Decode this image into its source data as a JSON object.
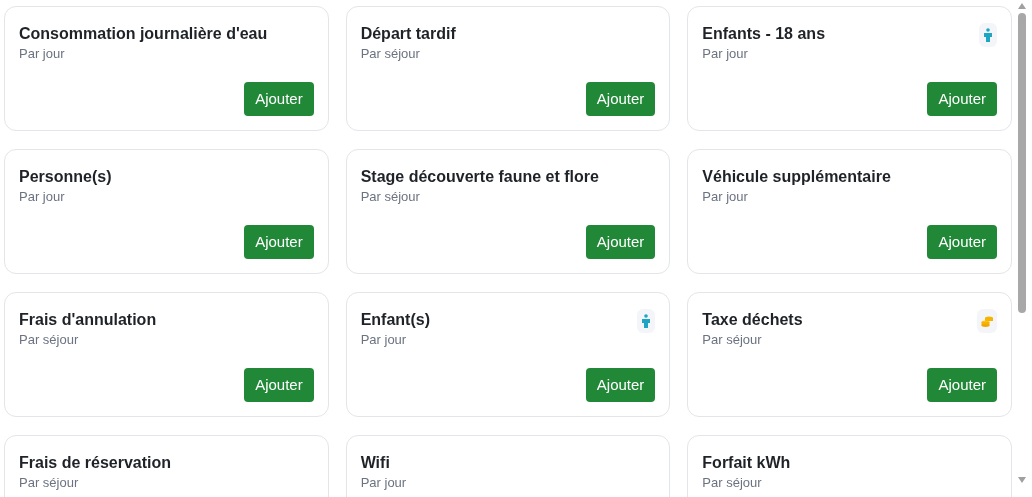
{
  "cards": [
    {
      "title": "Consommation journalière d'eau",
      "subtitle": "Par jour",
      "button": "Ajouter"
    },
    {
      "title": "Départ tardif",
      "subtitle": "Par séjour",
      "button": "Ajouter"
    },
    {
      "title": "Enfants - 18 ans",
      "subtitle": "Par jour",
      "button": "Ajouter",
      "kind": "person"
    },
    {
      "title": "Personne(s)",
      "subtitle": "Par jour",
      "button": "Ajouter"
    },
    {
      "title": "Stage découverte faune et flore",
      "subtitle": "Par séjour",
      "button": "Ajouter"
    },
    {
      "title": "Véhicule supplémentaire",
      "subtitle": "Par jour",
      "button": "Ajouter"
    },
    {
      "title": "Frais d'annulation",
      "subtitle": "Par séjour",
      "button": "Ajouter"
    },
    {
      "title": "Enfant(s)",
      "subtitle": "Par jour",
      "button": "Ajouter",
      "kind": "person"
    },
    {
      "title": "Taxe déchets",
      "subtitle": "Par séjour",
      "button": "Ajouter",
      "kind": "coins"
    },
    {
      "title": "Frais de réservation",
      "subtitle": "Par séjour"
    },
    {
      "title": "Wifi",
      "subtitle": "Par jour"
    },
    {
      "title": "Forfait kWh",
      "subtitle": "Par séjour"
    }
  ]
}
